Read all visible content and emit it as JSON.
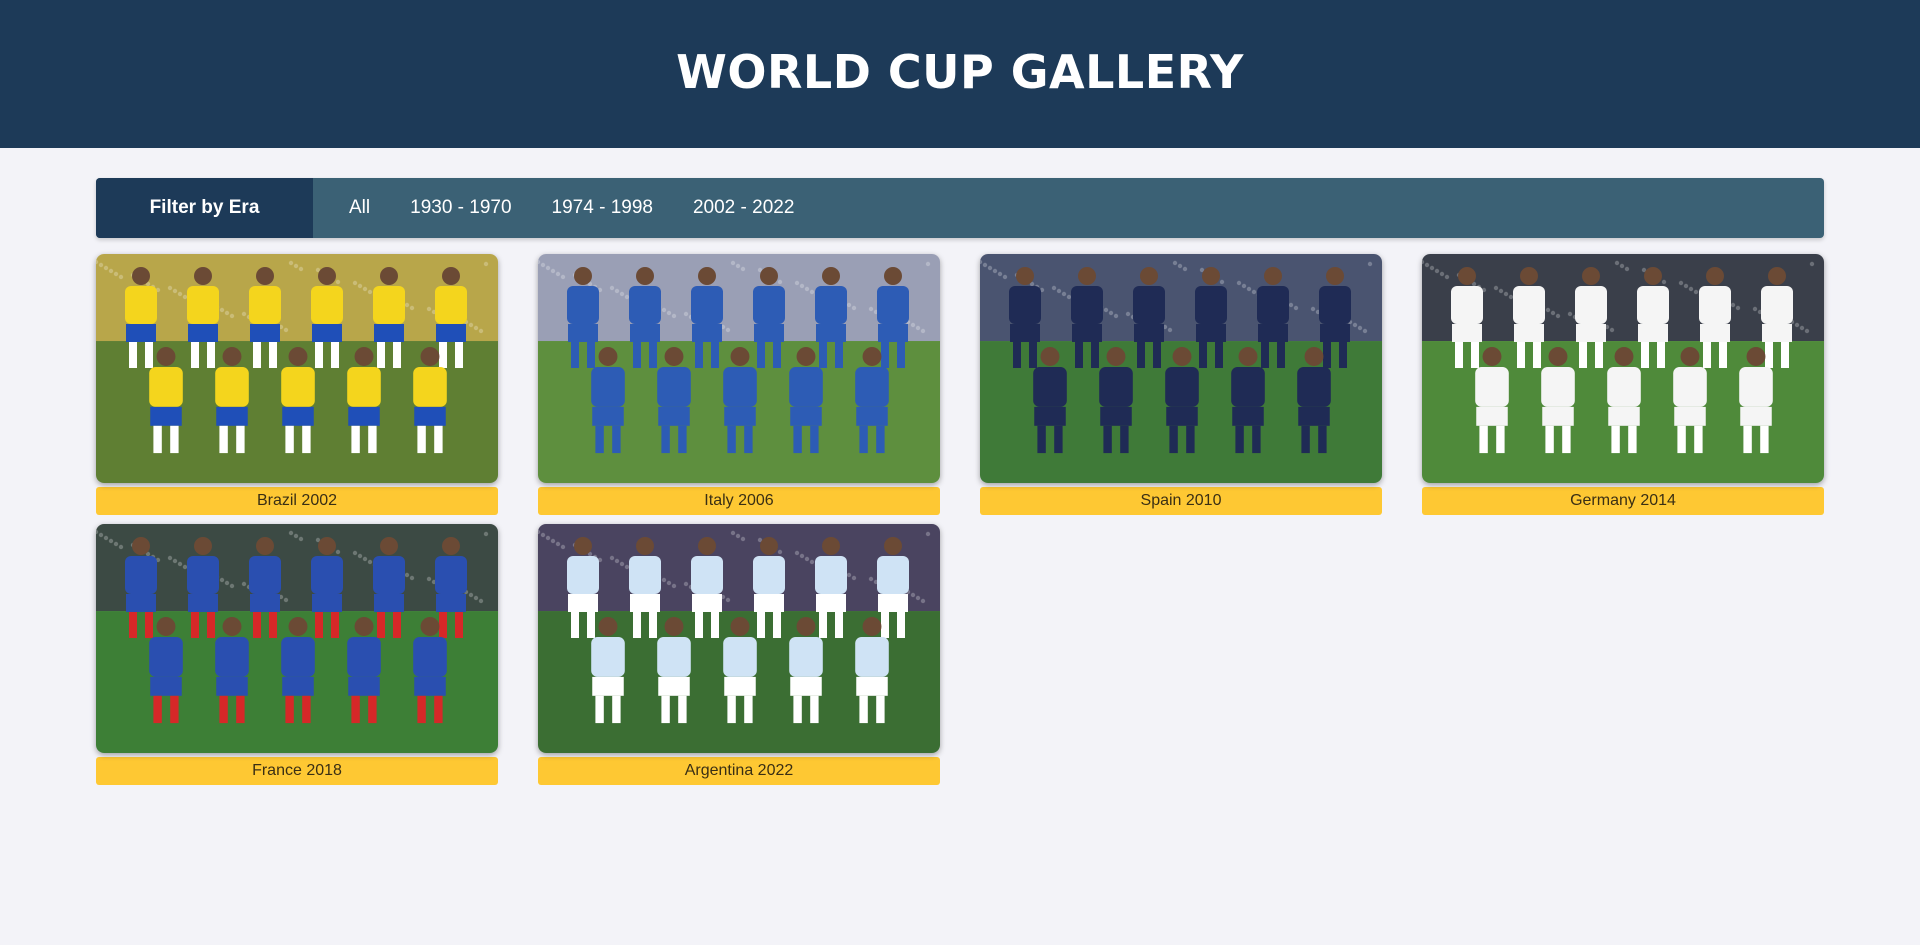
{
  "header": {
    "title": "WORLD CUP GALLERY"
  },
  "filter": {
    "label": "Filter by Era",
    "options": [
      "All",
      "1930 - 1970",
      "1974 - 1998",
      "2002 - 2022"
    ]
  },
  "gallery": [
    {
      "caption": "Brazil 2002",
      "shirt": "#f4d51d",
      "shorts": "#1f4fb8",
      "socks": "#ffffff",
      "crowd": "#b8a64a",
      "pitch": "#5f7f33"
    },
    {
      "caption": "Italy 2006",
      "shirt": "#2d5cb5",
      "shorts": "#2d5cb5",
      "socks": "#2d5cb5",
      "crowd": "#9a9fb5",
      "pitch": "#5e8f3e"
    },
    {
      "caption": "Spain 2010",
      "shirt": "#1f2b55",
      "shorts": "#1f2b55",
      "socks": "#1f2b55",
      "crowd": "#4a5470",
      "pitch": "#3f7a38"
    },
    {
      "caption": "Germany 2014",
      "shirt": "#f5f5f5",
      "shorts": "#f5f5f5",
      "socks": "#ffffff",
      "crowd": "#3a3f4a",
      "pitch": "#4f8a3a"
    },
    {
      "caption": "France 2018",
      "shirt": "#2a4fb0",
      "shorts": "#2a4fb0",
      "socks": "#d62828",
      "crowd": "#3c4a44",
      "pitch": "#3d7f36"
    },
    {
      "caption": "Argentina 2022",
      "shirt": "#cfe3f5",
      "shorts": "#ffffff",
      "socks": "#ffffff",
      "crowd": "#4a4460",
      "pitch": "#3b6e33"
    }
  ]
}
